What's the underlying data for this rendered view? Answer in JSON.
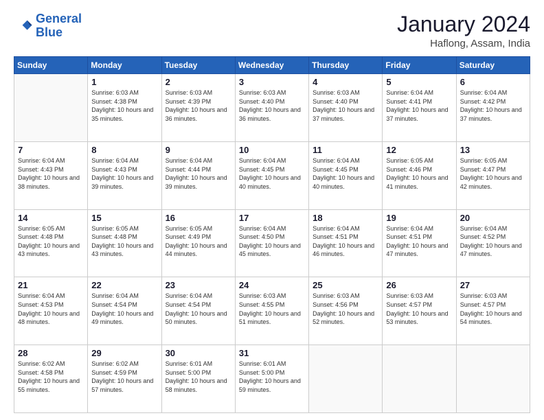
{
  "logo": {
    "line1": "General",
    "line2": "Blue"
  },
  "title": "January 2024",
  "subtitle": "Haflong, Assam, India",
  "header_days": [
    "Sunday",
    "Monday",
    "Tuesday",
    "Wednesday",
    "Thursday",
    "Friday",
    "Saturday"
  ],
  "weeks": [
    [
      null,
      {
        "num": "1",
        "sunrise": "6:03 AM",
        "sunset": "4:38 PM",
        "daylight": "10 hours and 35 minutes."
      },
      {
        "num": "2",
        "sunrise": "6:03 AM",
        "sunset": "4:39 PM",
        "daylight": "10 hours and 36 minutes."
      },
      {
        "num": "3",
        "sunrise": "6:03 AM",
        "sunset": "4:40 PM",
        "daylight": "10 hours and 36 minutes."
      },
      {
        "num": "4",
        "sunrise": "6:03 AM",
        "sunset": "4:40 PM",
        "daylight": "10 hours and 37 minutes."
      },
      {
        "num": "5",
        "sunrise": "6:04 AM",
        "sunset": "4:41 PM",
        "daylight": "10 hours and 37 minutes."
      },
      {
        "num": "6",
        "sunrise": "6:04 AM",
        "sunset": "4:42 PM",
        "daylight": "10 hours and 37 minutes."
      }
    ],
    [
      {
        "num": "7",
        "sunrise": "6:04 AM",
        "sunset": "4:43 PM",
        "daylight": "10 hours and 38 minutes."
      },
      {
        "num": "8",
        "sunrise": "6:04 AM",
        "sunset": "4:43 PM",
        "daylight": "10 hours and 39 minutes."
      },
      {
        "num": "9",
        "sunrise": "6:04 AM",
        "sunset": "4:44 PM",
        "daylight": "10 hours and 39 minutes."
      },
      {
        "num": "10",
        "sunrise": "6:04 AM",
        "sunset": "4:45 PM",
        "daylight": "10 hours and 40 minutes."
      },
      {
        "num": "11",
        "sunrise": "6:04 AM",
        "sunset": "4:45 PM",
        "daylight": "10 hours and 40 minutes."
      },
      {
        "num": "12",
        "sunrise": "6:05 AM",
        "sunset": "4:46 PM",
        "daylight": "10 hours and 41 minutes."
      },
      {
        "num": "13",
        "sunrise": "6:05 AM",
        "sunset": "4:47 PM",
        "daylight": "10 hours and 42 minutes."
      }
    ],
    [
      {
        "num": "14",
        "sunrise": "6:05 AM",
        "sunset": "4:48 PM",
        "daylight": "10 hours and 43 minutes."
      },
      {
        "num": "15",
        "sunrise": "6:05 AM",
        "sunset": "4:48 PM",
        "daylight": "10 hours and 43 minutes."
      },
      {
        "num": "16",
        "sunrise": "6:05 AM",
        "sunset": "4:49 PM",
        "daylight": "10 hours and 44 minutes."
      },
      {
        "num": "17",
        "sunrise": "6:04 AM",
        "sunset": "4:50 PM",
        "daylight": "10 hours and 45 minutes."
      },
      {
        "num": "18",
        "sunrise": "6:04 AM",
        "sunset": "4:51 PM",
        "daylight": "10 hours and 46 minutes."
      },
      {
        "num": "19",
        "sunrise": "6:04 AM",
        "sunset": "4:51 PM",
        "daylight": "10 hours and 47 minutes."
      },
      {
        "num": "20",
        "sunrise": "6:04 AM",
        "sunset": "4:52 PM",
        "daylight": "10 hours and 47 minutes."
      }
    ],
    [
      {
        "num": "21",
        "sunrise": "6:04 AM",
        "sunset": "4:53 PM",
        "daylight": "10 hours and 48 minutes."
      },
      {
        "num": "22",
        "sunrise": "6:04 AM",
        "sunset": "4:54 PM",
        "daylight": "10 hours and 49 minutes."
      },
      {
        "num": "23",
        "sunrise": "6:04 AM",
        "sunset": "4:54 PM",
        "daylight": "10 hours and 50 minutes."
      },
      {
        "num": "24",
        "sunrise": "6:03 AM",
        "sunset": "4:55 PM",
        "daylight": "10 hours and 51 minutes."
      },
      {
        "num": "25",
        "sunrise": "6:03 AM",
        "sunset": "4:56 PM",
        "daylight": "10 hours and 52 minutes."
      },
      {
        "num": "26",
        "sunrise": "6:03 AM",
        "sunset": "4:57 PM",
        "daylight": "10 hours and 53 minutes."
      },
      {
        "num": "27",
        "sunrise": "6:03 AM",
        "sunset": "4:57 PM",
        "daylight": "10 hours and 54 minutes."
      }
    ],
    [
      {
        "num": "28",
        "sunrise": "6:02 AM",
        "sunset": "4:58 PM",
        "daylight": "10 hours and 55 minutes."
      },
      {
        "num": "29",
        "sunrise": "6:02 AM",
        "sunset": "4:59 PM",
        "daylight": "10 hours and 57 minutes."
      },
      {
        "num": "30",
        "sunrise": "6:01 AM",
        "sunset": "5:00 PM",
        "daylight": "10 hours and 58 minutes."
      },
      {
        "num": "31",
        "sunrise": "6:01 AM",
        "sunset": "5:00 PM",
        "daylight": "10 hours and 59 minutes."
      },
      null,
      null,
      null
    ]
  ]
}
